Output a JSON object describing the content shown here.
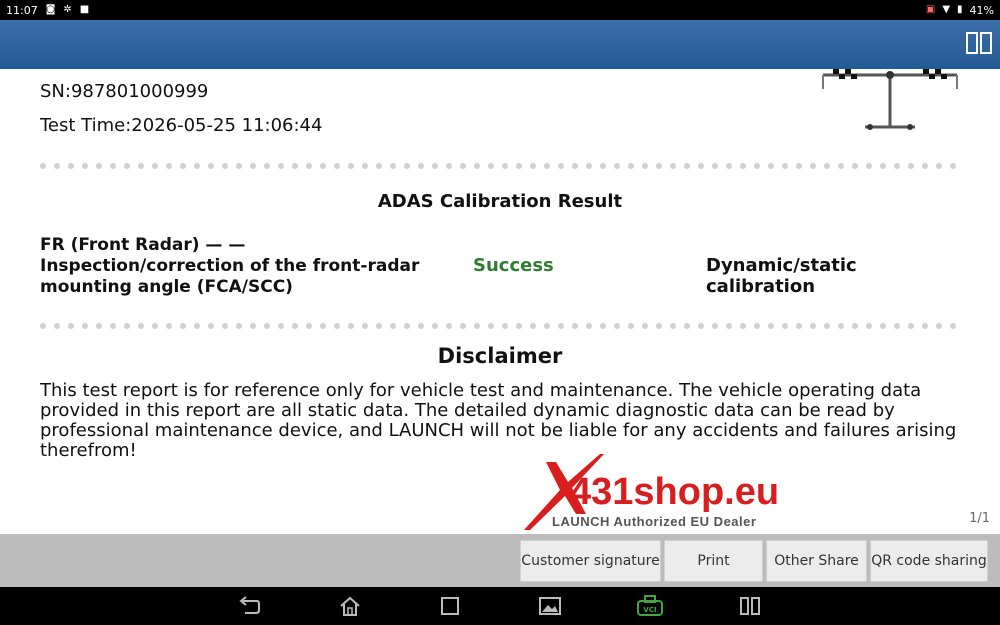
{
  "status_bar": {
    "time": "11:07",
    "battery": "41%",
    "left_icons": [
      "camera-icon",
      "settings-icon",
      "media-icon"
    ],
    "right_icons": [
      "cast-icon",
      "wifi-icon",
      "battery-icon"
    ]
  },
  "title_bar": {
    "split_view_icon": "split-view-icon"
  },
  "report": {
    "sn_label": "SN:987801000999",
    "test_time": "Test Time:2026-05-25 11:06:44",
    "result_title": "ADAS Calibration Result",
    "item": {
      "name_line1": "FR (Front Radar) — —",
      "name_line2": "Inspection/correction of the front-radar",
      "name_line3": "mounting angle (FCA/SCC)",
      "status": "Success",
      "type": "Dynamic/static calibration"
    },
    "disclaimer_title": "Disclaimer",
    "disclaimer_text": "This test report is for reference only for vehicle test and maintenance. The vehicle operating data provided in this report are all static data. The detailed dynamic diagnostic data can be read by professional maintenance device, and LAUNCH will not be liable for any accidents and failures arising therefrom!",
    "page_count": "1/1"
  },
  "watermark": {
    "brand": "X431shop.eu",
    "tagline": "LAUNCH Authorized EU Dealer"
  },
  "actions": {
    "customer_signature": "Customer signature",
    "print": "Print",
    "other_share": "Other Share",
    "qr_code_sharing": "QR code sharing"
  },
  "nav": {
    "icons": [
      "back-icon",
      "home-icon",
      "recents-icon",
      "screenshot-icon",
      "vci-icon",
      "split-screen-icon"
    ],
    "vci_label": "VCI"
  },
  "colors": {
    "title_bar": "#2d62a0",
    "success": "#2f7d32",
    "logo_red": "#d81e1e",
    "action_bar": "#bcbcbc"
  }
}
